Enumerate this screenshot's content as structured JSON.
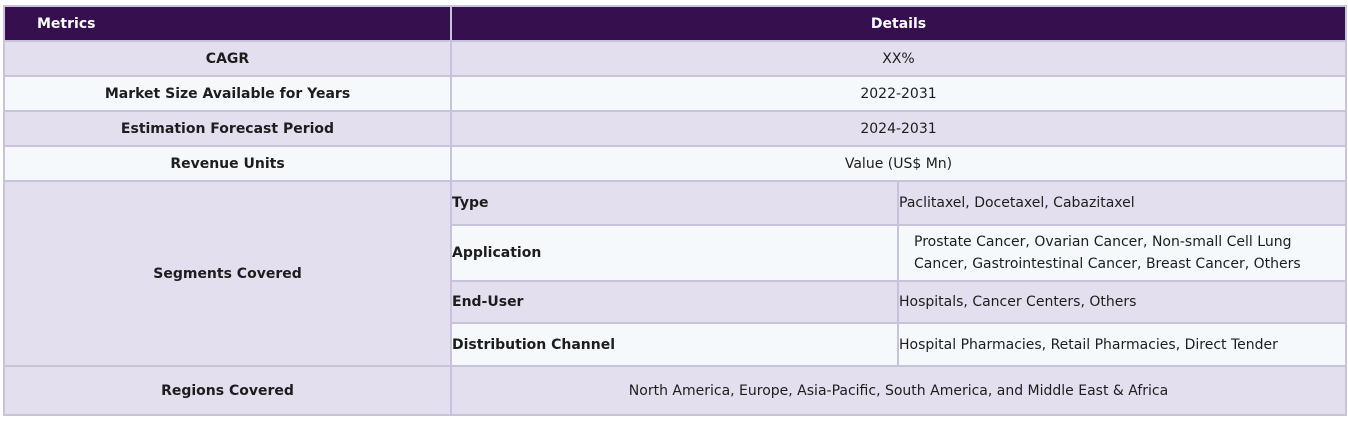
{
  "header": {
    "metrics": "Metrics",
    "details": "Details"
  },
  "rows": [
    {
      "metric": "CAGR",
      "value": "XX%"
    },
    {
      "metric": "Market Size Available for Years",
      "value": "2022-2031"
    },
    {
      "metric": "Estimation Forecast Period",
      "value": "2024-2031"
    },
    {
      "metric": "Revenue Units",
      "value": "Value (US$ Mn)"
    }
  ],
  "segments": {
    "label": "Segments Covered",
    "items": [
      {
        "key": "Type",
        "value": "Paclitaxel, Docetaxel, Cabazitaxel"
      },
      {
        "key": "Application",
        "value": "Prostate Cancer, Ovarian Cancer, Non-small Cell Lung Cancer, Gastrointestinal Cancer, Breast Cancer, Others"
      },
      {
        "key": "End-User",
        "value": "Hospitals, Cancer Centers, Others"
      },
      {
        "key": "Distribution Channel",
        "value": "Hospital Pharmacies, Retail Pharmacies, Direct Tender"
      }
    ]
  },
  "regions": {
    "label": "Regions Covered",
    "value": "North America, Europe, Asia-Pacific, South America, and Middle East & Africa"
  }
}
